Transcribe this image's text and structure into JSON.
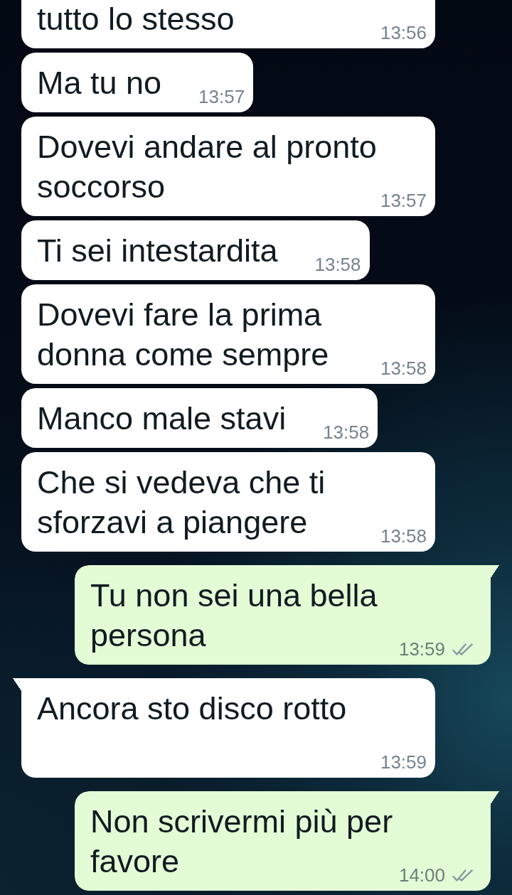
{
  "messages": [
    {
      "kind": "incoming",
      "text": "tutto lo stesso",
      "time": "13:56",
      "tail": false,
      "clipped": true
    },
    {
      "kind": "incoming",
      "text": "Ma tu no",
      "time": "13:57",
      "tail": false,
      "clipped": false
    },
    {
      "kind": "incoming",
      "text": "Dovevi andare al pronto soccorso",
      "time": "13:57",
      "tail": false,
      "clipped": false
    },
    {
      "kind": "incoming",
      "text": "Ti sei intestardita",
      "time": "13:58",
      "tail": false,
      "clipped": false
    },
    {
      "kind": "incoming",
      "text": "Dovevi fare la prima donna come sempre",
      "time": "13:58",
      "tail": false,
      "clipped": false
    },
    {
      "kind": "incoming",
      "text": "Manco male stavi",
      "time": "13:58",
      "tail": false,
      "clipped": false
    },
    {
      "kind": "incoming",
      "text": "Che si vedeva che ti sforzavi a piangere",
      "time": "13:58",
      "tail": false,
      "clipped": false
    },
    {
      "kind": "outgoing",
      "text": "Tu non sei una bella persona",
      "time": "13:59",
      "tail": true,
      "clipped": false,
      "read": false
    },
    {
      "kind": "incoming",
      "text": "Ancora sto disco rotto",
      "time": "13:59",
      "tail": true,
      "clipped": false
    },
    {
      "kind": "outgoing",
      "text": "Non scrivermi più per favore",
      "time": "14:00",
      "tail": true,
      "clipped": false,
      "read": false
    }
  ]
}
